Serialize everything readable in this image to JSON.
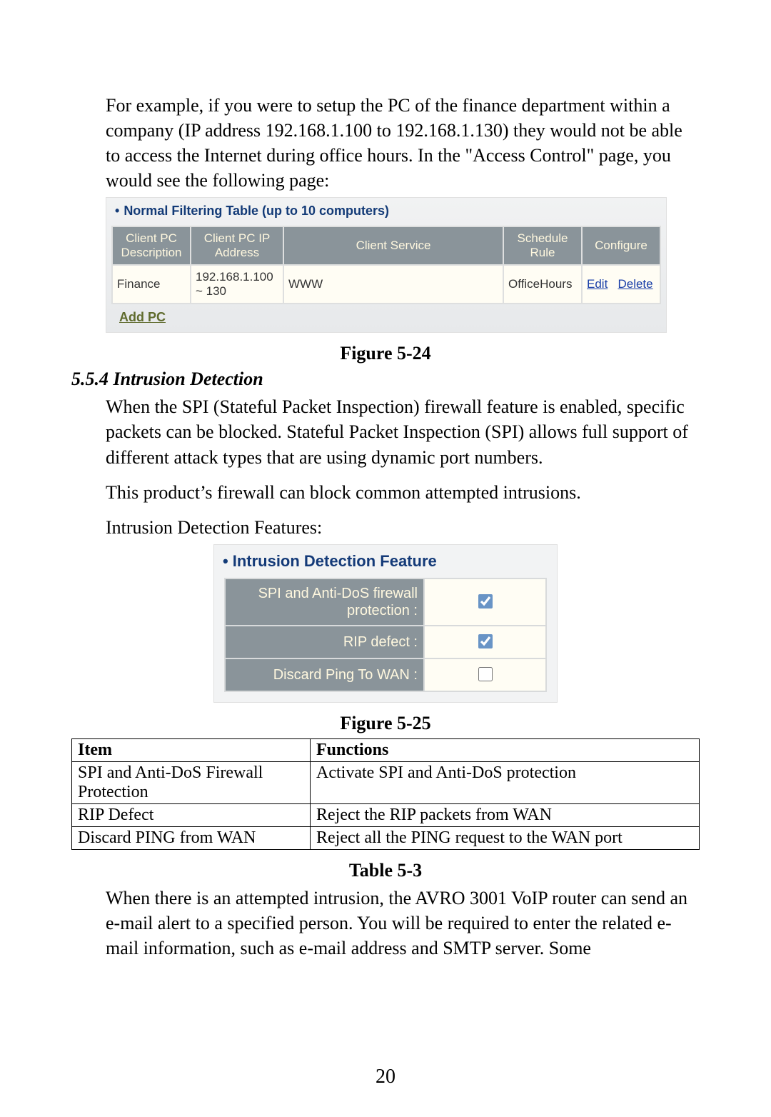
{
  "intro_paragraph": "For example, if you were to setup the PC of the finance department within a company (IP address 192.168.1.100 to 192.168.1.130) they would not be able to access the Internet during office hours. In the \"Access Control\" page, you would see the following page:",
  "figure524": {
    "title": "Normal Filtering Table (up to 10 computers)",
    "headers": [
      "Client PC Description",
      "Client PC IP Address",
      "Client Service",
      "Schedule Rule",
      "Configure"
    ],
    "row": {
      "desc": "Finance",
      "ip": "192.168.1.100 ~ 130",
      "service": "WWW",
      "rule": "OfficeHours",
      "edit": "Edit",
      "del": "Delete"
    },
    "add_pc": "Add PC",
    "caption": "Figure 5-24"
  },
  "section_heading": "5.5.4 Intrusion Detection",
  "spi_par1": "When the SPI (Stateful Packet Inspection) firewall feature is enabled, specific packets can be blocked. Stateful Packet Inspection (SPI) allows full support of different attack types that are using dynamic port numbers.",
  "spi_par2": "This product’s firewall can block common attempted intrusions.",
  "spi_par3": "Intrusion Detection Features:",
  "figure525": {
    "title": "Intrusion Detection Feature",
    "rows": [
      {
        "label": "SPI and Anti-DoS firewall protection :",
        "checked": true
      },
      {
        "label": "RIP defect :",
        "checked": true
      },
      {
        "label": "Discard Ping To WAN :",
        "checked": false
      }
    ],
    "caption": "Figure 5-25"
  },
  "func_table": {
    "headers": [
      "Item",
      "Functions"
    ],
    "rows": [
      [
        "SPI and Anti-DoS Firewall Protection",
        "Activate SPI and Anti-DoS protection"
      ],
      [
        "RIP Defect",
        "Reject the RIP packets from WAN"
      ],
      [
        "Discard PING from WAN",
        "Reject all the PING request to the WAN port"
      ]
    ],
    "caption": "Table 5-3"
  },
  "tail_paragraph": "When there is an attempted intrusion, the AVRO 3001 VoIP router can send an e-mail alert to a specified person. You will be required to enter the related e-mail information, such as e-mail address and SMTP server. Some",
  "page_number": "20"
}
